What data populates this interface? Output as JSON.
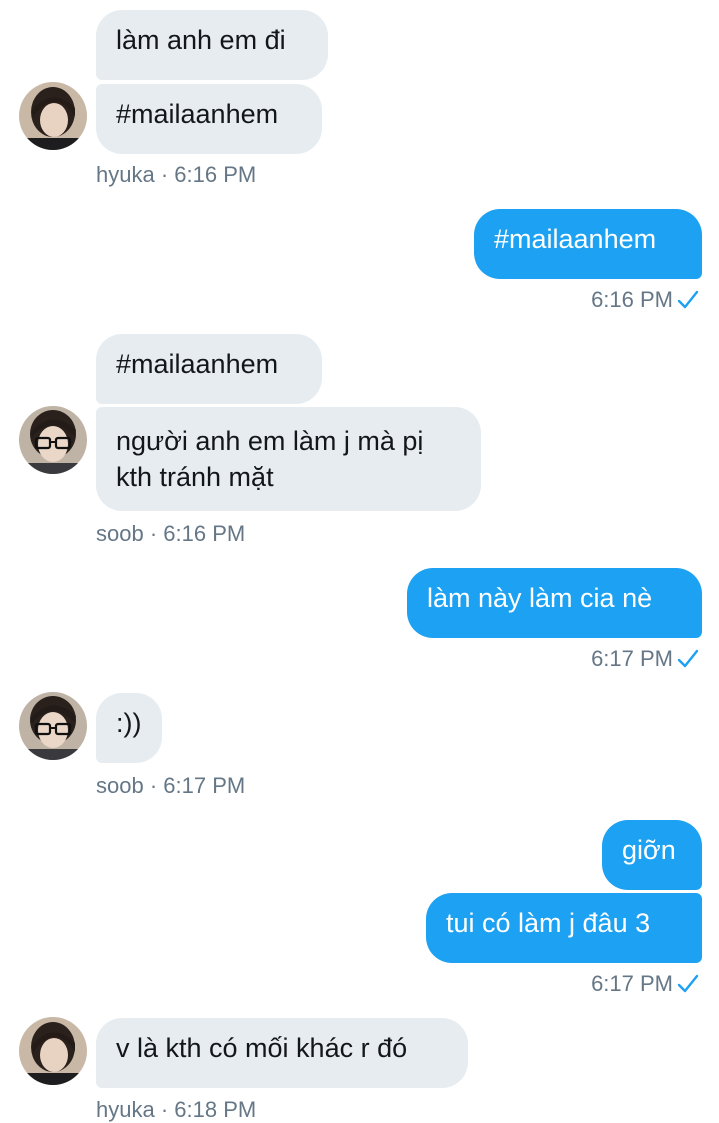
{
  "colors": {
    "incoming_bubble": "#e6ecf0",
    "outgoing_bubble": "#1da1f2",
    "meta_text": "#657786",
    "check": "#1da1f2"
  },
  "icons": {
    "read_receipt": "check-icon"
  },
  "messages": {
    "m1": {
      "text": "làm anh em đi"
    },
    "m2": {
      "text": "#mailaanhem"
    },
    "m2_meta": {
      "sender": "hyuka",
      "sep": " · ",
      "time": "6:16 PM"
    },
    "m3": {
      "text": "#mailaanhem"
    },
    "m3_meta": {
      "time": "6:16 PM"
    },
    "m4": {
      "text": "#mailaanhem"
    },
    "m5": {
      "text": "người anh em làm j mà pị kth tránh mặt"
    },
    "m5_meta": {
      "sender": "soob",
      "sep": " · ",
      "time": "6:16 PM"
    },
    "m6": {
      "text": "làm này làm cia nè"
    },
    "m6_meta": {
      "time": "6:17 PM"
    },
    "m7": {
      "text": ":))"
    },
    "m7_meta": {
      "sender": "soob",
      "sep": " · ",
      "time": "6:17 PM"
    },
    "m8": {
      "text": "giỡn"
    },
    "m9": {
      "text": "tui có làm j đâu 3"
    },
    "m9_meta": {
      "time": "6:17 PM"
    },
    "m10": {
      "text": "v là kth có mối khác r đó"
    },
    "m10_meta": {
      "sender": "hyuka",
      "sep": " · ",
      "time": "6:18 PM"
    }
  }
}
